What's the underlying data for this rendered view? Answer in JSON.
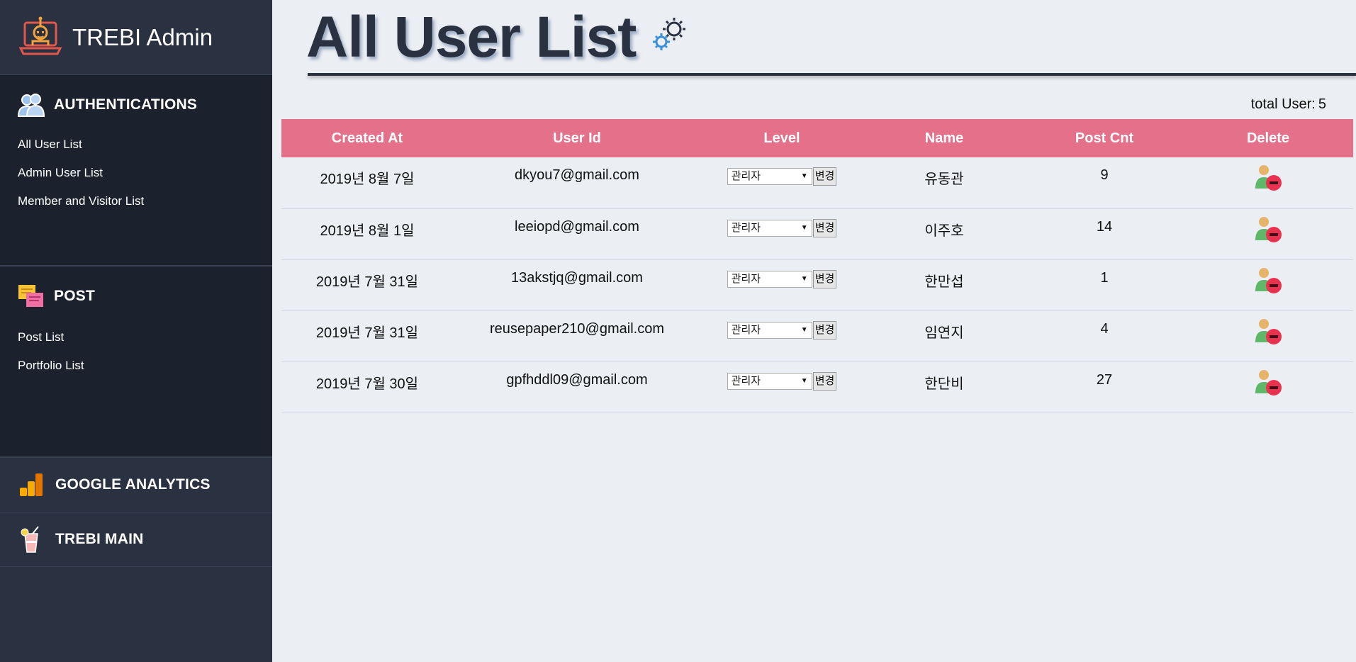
{
  "brand": {
    "title": "TREBI Admin"
  },
  "sidebar": {
    "auth": {
      "title": "AUTHENTICATIONS",
      "items": [
        "All User List",
        "Admin User List",
        "Member and Visitor List"
      ]
    },
    "post": {
      "title": "POST",
      "items": [
        "Post List",
        "Portfolio List"
      ]
    },
    "analytics": {
      "title": "GOOGLE ANALYTICS"
    },
    "main": {
      "title": "TREBI MAIN"
    }
  },
  "page": {
    "title": "All User List",
    "total_label": "total User:",
    "total_value": "5"
  },
  "table": {
    "headers": [
      "Created At",
      "User Id",
      "Level",
      "Name",
      "Post Cnt",
      "Delete"
    ],
    "level_button": "변경",
    "rows": [
      {
        "created": "2019년 8월 7일",
        "user_id": "dkyou7@gmail.com",
        "level": "관리자",
        "name": "유동관",
        "posts": "9"
      },
      {
        "created": "2019년 8월 1일",
        "user_id": "leeiopd@gmail.com",
        "level": "관리자",
        "name": "이주호",
        "posts": "14"
      },
      {
        "created": "2019년 7월 31일",
        "user_id": "13akstjq@gmail.com",
        "level": "관리자",
        "name": "한만섭",
        "posts": "1"
      },
      {
        "created": "2019년 7월 31일",
        "user_id": "reusepaper210@gmail.com",
        "level": "관리자",
        "name": "임연지",
        "posts": "4"
      },
      {
        "created": "2019년 7월 30일",
        "user_id": "gpfhddl09@gmail.com",
        "level": "관리자",
        "name": "한단비",
        "posts": "27"
      }
    ]
  },
  "colors": {
    "sidebar_bg": "#2a3140",
    "section_bg": "#1c222d",
    "header_row": "#e5708a",
    "main_bg": "#ebeef2"
  }
}
